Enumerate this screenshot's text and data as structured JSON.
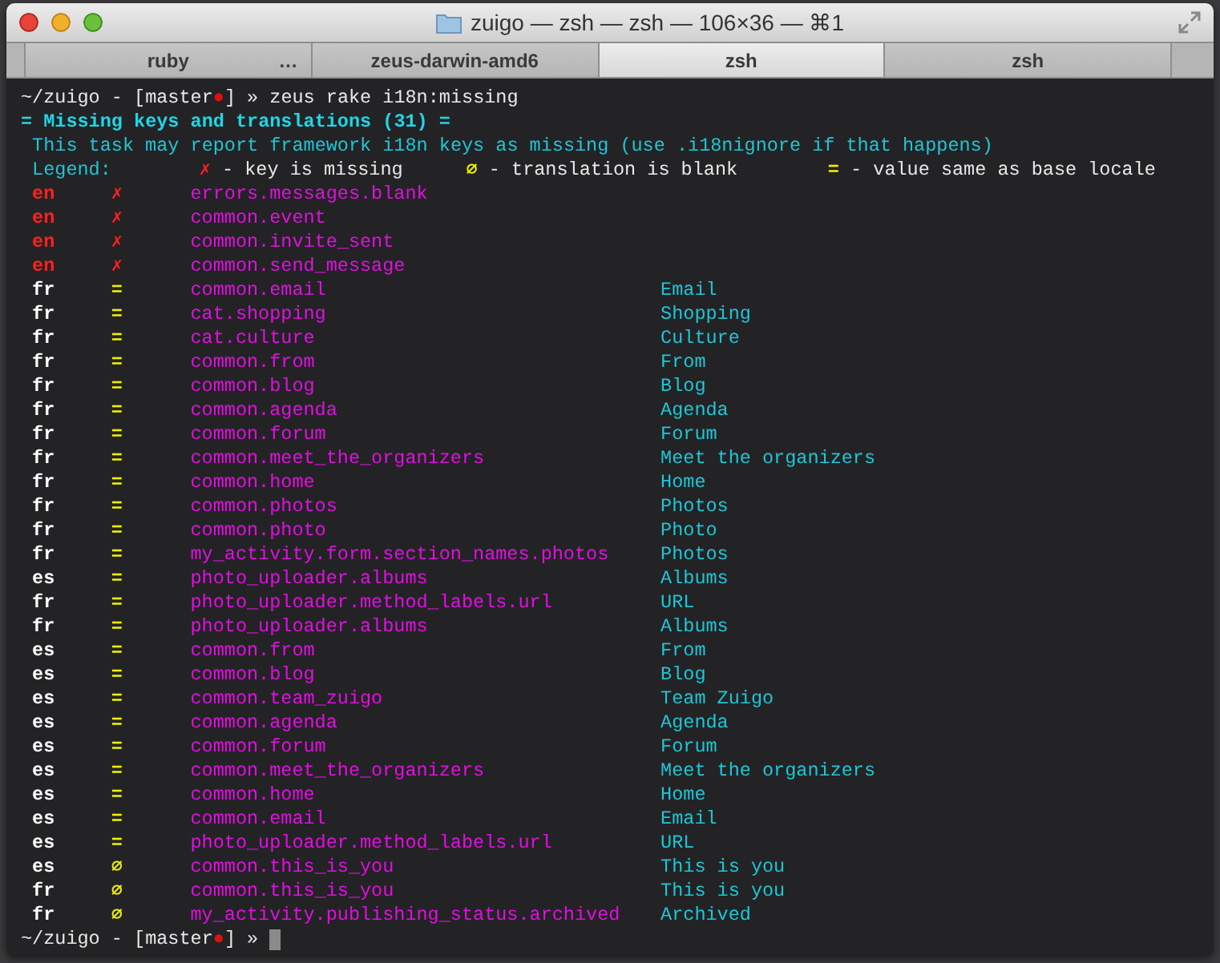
{
  "window": {
    "title": "zuigo — zsh — zsh — 106×36 — ⌘1"
  },
  "tabs": [
    {
      "label": "ruby",
      "more": "…",
      "selected": false
    },
    {
      "label": "zeus-darwin-amd6",
      "selected": false
    },
    {
      "label": "zsh",
      "selected": true
    },
    {
      "label": "zsh",
      "selected": false
    }
  ],
  "terminal": {
    "prompt": {
      "path": "~/zuigo - [master",
      "dot": "●",
      "close": "] »",
      "command": "zeus rake i18n:missing"
    },
    "header": "= Missing keys and translations (31) =",
    "note": "This task may report framework i18n keys as missing (use .i18nignore if that happens)",
    "legend": {
      "label": "Legend:",
      "items": [
        {
          "kind": "missing",
          "symbol": "✗",
          "text": "- key is missing"
        },
        {
          "kind": "blank",
          "symbol": "∅",
          "text": "- translation is blank"
        },
        {
          "kind": "same",
          "symbol": "=",
          "text": "- value same as base locale"
        }
      ]
    },
    "rows": [
      {
        "locale": "en",
        "kind": "missing",
        "symbol": "✗",
        "key": "errors.messages.blank"
      },
      {
        "locale": "en",
        "kind": "missing",
        "symbol": "✗",
        "key": "common.event"
      },
      {
        "locale": "en",
        "kind": "missing",
        "symbol": "✗",
        "key": "common.invite_sent"
      },
      {
        "locale": "en",
        "kind": "missing",
        "symbol": "✗",
        "key": "common.send_message"
      },
      {
        "locale": "fr",
        "kind": "same",
        "symbol": "=",
        "key": "common.email",
        "value": "Email"
      },
      {
        "locale": "fr",
        "kind": "same",
        "symbol": "=",
        "key": "cat.shopping",
        "value": "Shopping"
      },
      {
        "locale": "fr",
        "kind": "same",
        "symbol": "=",
        "key": "cat.culture",
        "value": "Culture"
      },
      {
        "locale": "fr",
        "kind": "same",
        "symbol": "=",
        "key": "common.from",
        "value": "From"
      },
      {
        "locale": "fr",
        "kind": "same",
        "symbol": "=",
        "key": "common.blog",
        "value": "Blog"
      },
      {
        "locale": "fr",
        "kind": "same",
        "symbol": "=",
        "key": "common.agenda",
        "value": "Agenda"
      },
      {
        "locale": "fr",
        "kind": "same",
        "symbol": "=",
        "key": "common.forum",
        "value": "Forum"
      },
      {
        "locale": "fr",
        "kind": "same",
        "symbol": "=",
        "key": "common.meet_the_organizers",
        "value": "Meet the organizers"
      },
      {
        "locale": "fr",
        "kind": "same",
        "symbol": "=",
        "key": "common.home",
        "value": "Home"
      },
      {
        "locale": "fr",
        "kind": "same",
        "symbol": "=",
        "key": "common.photos",
        "value": "Photos"
      },
      {
        "locale": "fr",
        "kind": "same",
        "symbol": "=",
        "key": "common.photo",
        "value": "Photo"
      },
      {
        "locale": "fr",
        "kind": "same",
        "symbol": "=",
        "key": "my_activity.form.section_names.photos",
        "value": "Photos"
      },
      {
        "locale": "es",
        "kind": "same",
        "symbol": "=",
        "key": "photo_uploader.albums",
        "value": "Albums"
      },
      {
        "locale": "fr",
        "kind": "same",
        "symbol": "=",
        "key": "photo_uploader.method_labels.url",
        "value": "URL"
      },
      {
        "locale": "fr",
        "kind": "same",
        "symbol": "=",
        "key": "photo_uploader.albums",
        "value": "Albums"
      },
      {
        "locale": "es",
        "kind": "same",
        "symbol": "=",
        "key": "common.from",
        "value": "From"
      },
      {
        "locale": "es",
        "kind": "same",
        "symbol": "=",
        "key": "common.blog",
        "value": "Blog"
      },
      {
        "locale": "es",
        "kind": "same",
        "symbol": "=",
        "key": "common.team_zuigo",
        "value": "Team Zuigo"
      },
      {
        "locale": "es",
        "kind": "same",
        "symbol": "=",
        "key": "common.agenda",
        "value": "Agenda"
      },
      {
        "locale": "es",
        "kind": "same",
        "symbol": "=",
        "key": "common.forum",
        "value": "Forum"
      },
      {
        "locale": "es",
        "kind": "same",
        "symbol": "=",
        "key": "common.meet_the_organizers",
        "value": "Meet the organizers"
      },
      {
        "locale": "es",
        "kind": "same",
        "symbol": "=",
        "key": "common.home",
        "value": "Home"
      },
      {
        "locale": "es",
        "kind": "same",
        "symbol": "=",
        "key": "common.email",
        "value": "Email"
      },
      {
        "locale": "es",
        "kind": "same",
        "symbol": "=",
        "key": "photo_uploader.method_labels.url",
        "value": "URL"
      },
      {
        "locale": "es",
        "kind": "blank",
        "symbol": "∅",
        "key": "common.this_is_you",
        "value": "This is you"
      },
      {
        "locale": "fr",
        "kind": "blank",
        "symbol": "∅",
        "key": "common.this_is_you",
        "value": "This is you"
      },
      {
        "locale": "fr",
        "kind": "blank",
        "symbol": "∅",
        "key": "my_activity.publishing_status.archived",
        "value": "Archived"
      }
    ],
    "end_prompt": {
      "path": "~/zuigo - [master",
      "dot": "●",
      "close": "] »"
    }
  }
}
